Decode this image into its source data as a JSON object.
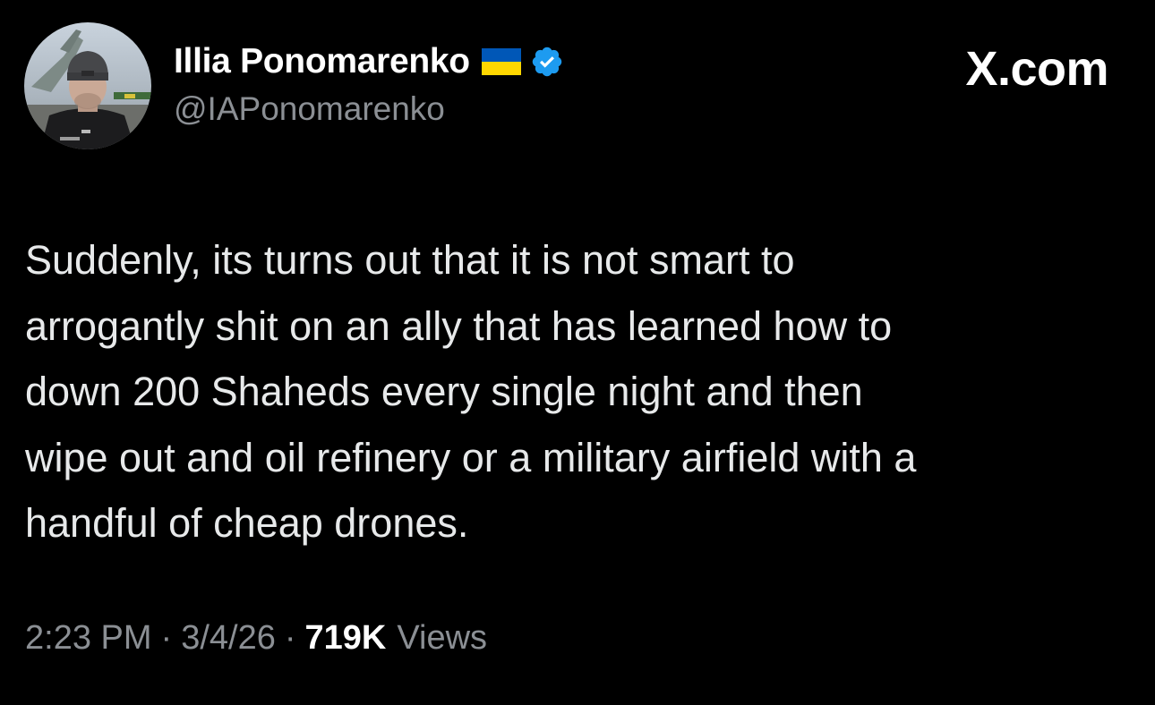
{
  "author": {
    "display_name": "Illia Ponomarenko",
    "handle": "@IAPonomarenko",
    "flag_icon": "ukraine-flag-icon",
    "verified_icon": "verified-badge-icon"
  },
  "site_label": "X.com",
  "tweet": {
    "lines": [
      "Suddenly, its turns out that it is not smart to",
      "arrogantly shit on an ally that has learned how to",
      "down 200 Shaheds every single night and then",
      "wipe out and oil refinery or a military airfield with a",
      "handful of cheap drones."
    ]
  },
  "meta": {
    "time": "2:23 PM",
    "separator": "·",
    "date": "3/4/26",
    "views_count": "719K",
    "views_label": "Views"
  },
  "colors": {
    "background": "#000000",
    "text": "#e7e9ea",
    "secondary_text": "#8b8f94",
    "verified_blue": "#1d9bf0",
    "flag_blue": "#0057b7",
    "flag_yellow": "#ffd700"
  }
}
